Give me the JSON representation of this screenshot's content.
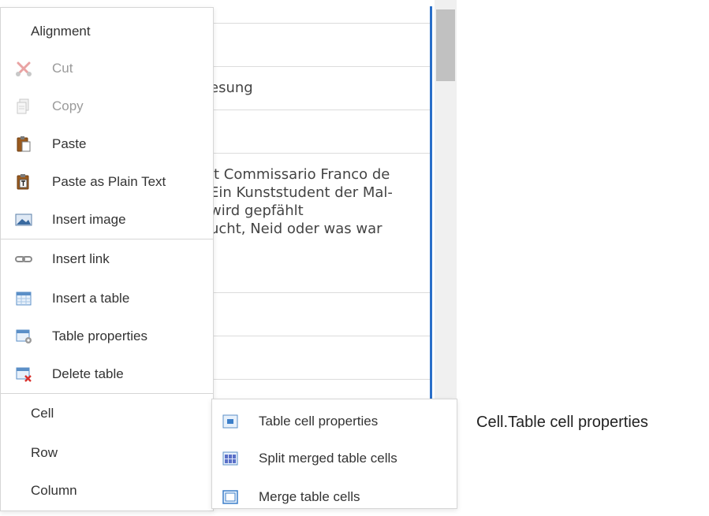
{
  "editor": {
    "heading_fragment": "esung",
    "paragraph_lines": [
      "it Commissario Franco de",
      "Ein Kunststudent der Mal-",
      "wird gepfählt",
      "ucht, Neid oder was war"
    ]
  },
  "context_menu": {
    "items": [
      {
        "label": "Alignment",
        "icon": null,
        "disabled": false
      },
      {
        "label": "Cut",
        "icon": "cut-icon",
        "disabled": true
      },
      {
        "label": "Copy",
        "icon": "copy-icon",
        "disabled": true
      },
      {
        "label": "Paste",
        "icon": "paste-icon",
        "disabled": false
      },
      {
        "label": "Paste as Plain Text",
        "icon": "paste-plain-text-icon",
        "disabled": false
      },
      {
        "label": "Insert image",
        "icon": "image-icon",
        "disabled": false
      },
      {
        "label": "Insert link",
        "icon": "link-icon",
        "disabled": false
      },
      {
        "label": "Insert a table",
        "icon": "table-icon",
        "disabled": false
      },
      {
        "label": "Table properties",
        "icon": "table-properties-icon",
        "disabled": false
      },
      {
        "label": "Delete table",
        "icon": "delete-table-icon",
        "disabled": false
      },
      {
        "label": "Cell",
        "icon": null,
        "disabled": false
      },
      {
        "label": "Row",
        "icon": null,
        "disabled": false
      },
      {
        "label": "Column",
        "icon": null,
        "disabled": false
      }
    ]
  },
  "cell_submenu": {
    "items": [
      {
        "label": "Table cell properties",
        "icon": "cell-properties-icon"
      },
      {
        "label": "Split merged table cells",
        "icon": "split-cells-icon"
      },
      {
        "label": "Merge table cells",
        "icon": "merge-cells-icon"
      }
    ]
  },
  "annotation": "Cell.Table cell properties",
  "colors": {
    "accent_line": "#2a6fc9",
    "disabled_text": "#9a9a9a",
    "delete_red": "#d9302c"
  }
}
